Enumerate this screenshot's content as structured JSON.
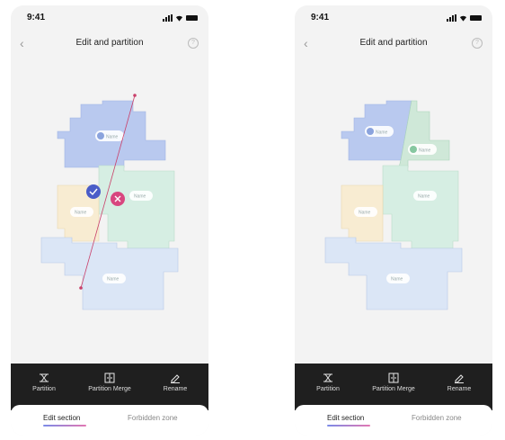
{
  "screens": [
    {
      "status_time": "9:41",
      "title": "Edit and partition",
      "back_icon": "chevron-left-icon",
      "help_icon": "question-circle-icon",
      "room_labels": [
        "Name",
        "Name",
        "Name",
        "Name"
      ],
      "tools": [
        {
          "label": "Partition",
          "icon": "partition-icon"
        },
        {
          "label": "Partition Merge",
          "icon": "merge-icon"
        },
        {
          "label": "Rename",
          "icon": "pencil-icon"
        }
      ],
      "tabs": [
        "Edit section",
        "Forbidden zone"
      ],
      "active_tab": "Edit section"
    },
    {
      "status_time": "9:41",
      "title": "Edit and partition",
      "back_icon": "chevron-left-icon",
      "help_icon": "question-circle-icon",
      "room_labels": [
        "Name",
        "Name",
        "Name",
        "Name",
        "Name"
      ],
      "tools": [
        {
          "label": "Partition",
          "icon": "partition-icon"
        },
        {
          "label": "Partition Merge",
          "icon": "merge-icon"
        },
        {
          "label": "Rename",
          "icon": "pencil-icon"
        }
      ],
      "tabs": [
        "Edit section",
        "Forbidden zone"
      ],
      "active_tab": "Edit section"
    }
  ],
  "colors": {
    "room_blue": "#b9c9ef",
    "room_green": "#d6eee3",
    "room_yellow": "#f8ecd2",
    "room_lightblue": "#dbe6f6",
    "partition_line": "#c9406a",
    "confirm_button": "#4a5cc8",
    "cancel_button": "#d8467f"
  }
}
